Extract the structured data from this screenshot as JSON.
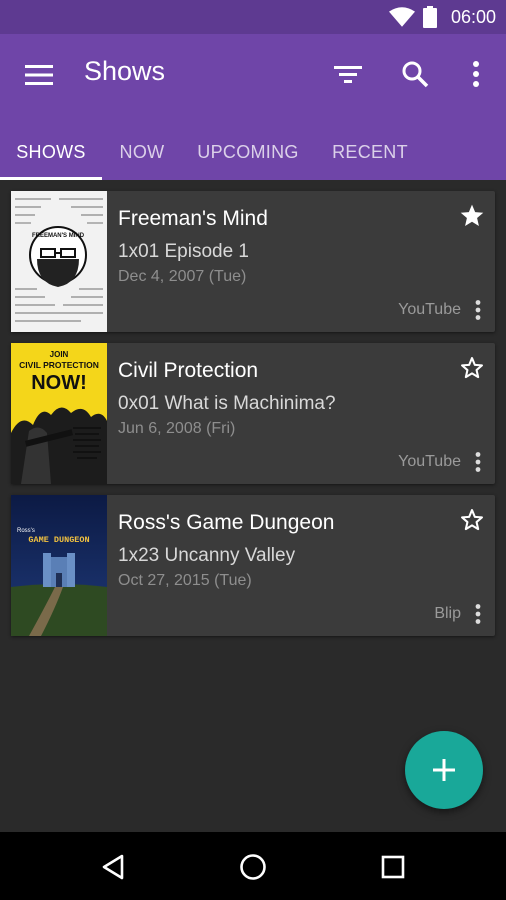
{
  "status_bar": {
    "time": "06:00"
  },
  "app_bar": {
    "title": "Shows",
    "icons": [
      "menu-icon",
      "filter-icon",
      "search-icon",
      "more-vert-icon"
    ]
  },
  "tabs": [
    {
      "label": "SHOWS",
      "active": true
    },
    {
      "label": "NOW",
      "active": false
    },
    {
      "label": "UPCOMING",
      "active": false
    },
    {
      "label": "RECENT",
      "active": false
    }
  ],
  "shows": [
    {
      "title": "Freeman's Mind",
      "episode": "1x01 Episode 1",
      "date": "Dec 4, 2007 (Tue)",
      "network": "YouTube",
      "favorite": true,
      "poster": {
        "heading": "FREEMAN'S MIND"
      }
    },
    {
      "title": "Civil Protection",
      "episode": "0x01 What is Machinima?",
      "date": "Jun 6, 2008 (Fri)",
      "network": "YouTube",
      "favorite": false,
      "poster": {
        "line1": "JOIN",
        "line2": "CIVIL PROTECTION",
        "line3": "NOW!"
      }
    },
    {
      "title": "Ross's Game Dungeon",
      "episode": "1x23 Uncanny Valley",
      "date": "Oct 27, 2015 (Tue)",
      "network": "Blip",
      "favorite": false,
      "poster": {
        "line1": "Ross's",
        "line2": "GAME DUNGEON"
      }
    }
  ],
  "colors": {
    "primary": "#6f45a8",
    "primary_dark": "#5e3a91",
    "accent": "#19a899",
    "background": "#2a2a2a",
    "card": "#3b3b3b"
  }
}
